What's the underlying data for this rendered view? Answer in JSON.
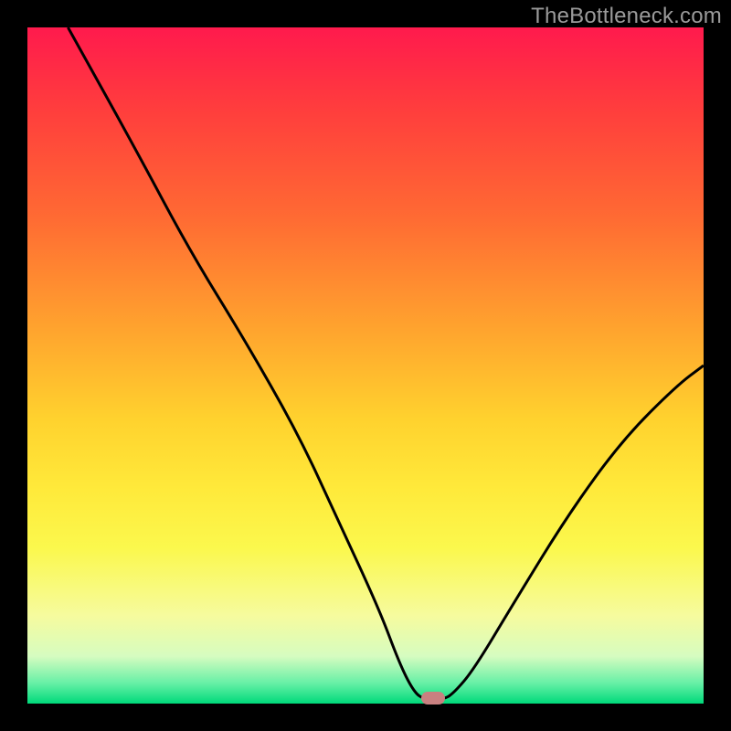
{
  "watermark": "TheBottleneck.com",
  "chart_data": {
    "type": "line",
    "title": "",
    "xlabel": "",
    "ylabel": "",
    "xlim": [
      0,
      100
    ],
    "ylim": [
      0,
      100
    ],
    "curve_points": [
      {
        "x": 6,
        "y": 100
      },
      {
        "x": 16,
        "y": 82
      },
      {
        "x": 24,
        "y": 67
      },
      {
        "x": 32,
        "y": 54
      },
      {
        "x": 40,
        "y": 40
      },
      {
        "x": 46,
        "y": 27
      },
      {
        "x": 52,
        "y": 14
      },
      {
        "x": 55,
        "y": 6
      },
      {
        "x": 57,
        "y": 2
      },
      {
        "x": 58.5,
        "y": 0.6
      },
      {
        "x": 61.5,
        "y": 0.6
      },
      {
        "x": 63,
        "y": 1.5
      },
      {
        "x": 66,
        "y": 5
      },
      {
        "x": 72,
        "y": 15
      },
      {
        "x": 80,
        "y": 28
      },
      {
        "x": 88,
        "y": 39
      },
      {
        "x": 96,
        "y": 47
      },
      {
        "x": 100,
        "y": 50
      }
    ],
    "marker": {
      "x": 60,
      "y": 0.8
    },
    "marker_color": "#c98080",
    "curve_color": "#000000",
    "curve_width": 3
  }
}
